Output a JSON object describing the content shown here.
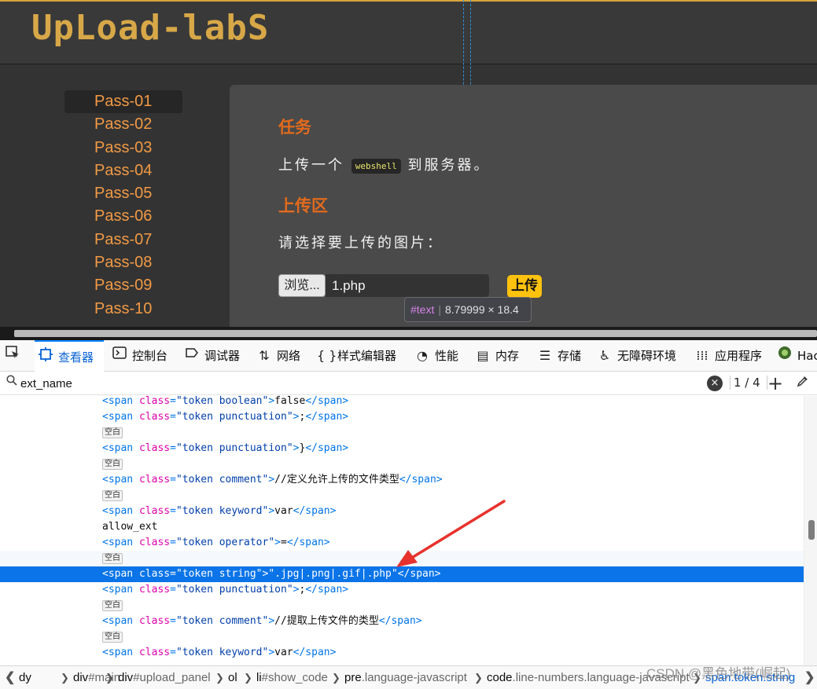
{
  "page": {
    "logo": "UpLoad-labS",
    "menu": [
      "Pass-01",
      "Pass-02",
      "Pass-03",
      "Pass-04",
      "Pass-05",
      "Pass-06",
      "Pass-07",
      "Pass-08",
      "Pass-09",
      "Pass-10"
    ],
    "task_title": "任务",
    "task_pre": "上传一个",
    "task_code": "webshell",
    "task_post": "到服务器。",
    "upload_title": "上传区",
    "upload_prompt": "请选择要上传的图片：",
    "browse_label": "浏览...",
    "file_name": "1.php",
    "upload_button": "上传",
    "tooltip_node": "#text",
    "tooltip_size": "8.79999 × 18.4"
  },
  "devtools": {
    "tabs": [
      {
        "label": "查看器",
        "icon": "inspector-icon"
      },
      {
        "label": "控制台",
        "icon": "console-icon"
      },
      {
        "label": "调试器",
        "icon": "debugger-icon"
      },
      {
        "label": "网络",
        "icon": "network-icon"
      },
      {
        "label": "样式编辑器",
        "icon": "style-editor-icon"
      },
      {
        "label": "性能",
        "icon": "performance-icon"
      },
      {
        "label": "内存",
        "icon": "memory-icon"
      },
      {
        "label": "存储",
        "icon": "storage-icon"
      },
      {
        "label": "无障碍环境",
        "icon": "accessibility-icon"
      },
      {
        "label": "应用程序",
        "icon": "application-icon"
      },
      {
        "label": "Hac",
        "icon": "hackbar-icon"
      }
    ],
    "search_value": "ext_name",
    "match_count": "1 / 4",
    "whitespace_badge": "空白",
    "rows": [
      {
        "kind": "span",
        "cls": "token boolean",
        "text": "false"
      },
      {
        "kind": "span",
        "cls": "token punctuation",
        "text": ";"
      },
      {
        "kind": "badge"
      },
      {
        "kind": "span",
        "cls": "token punctuation",
        "text": "}"
      },
      {
        "kind": "badge"
      },
      {
        "kind": "span",
        "cls": "token comment",
        "text": "//定义允许上传的文件类型"
      },
      {
        "kind": "badge"
      },
      {
        "kind": "span",
        "cls": "token keyword",
        "text": "var"
      },
      {
        "kind": "text",
        "text": "allow_ext"
      },
      {
        "kind": "span",
        "cls": "token operator",
        "text": "="
      },
      {
        "kind": "badge"
      },
      {
        "kind": "span",
        "cls": "token string",
        "text": "\".jpg|.png|.gif|.php\"",
        "highlight": true
      },
      {
        "kind": "span",
        "cls": "token punctuation",
        "text": ";"
      },
      {
        "kind": "badge"
      },
      {
        "kind": "span",
        "cls": "token comment",
        "text": "//提取上传文件的类型"
      },
      {
        "kind": "badge"
      },
      {
        "kind": "span",
        "cls": "token keyword",
        "text": "var"
      }
    ],
    "breadcrumbs": [
      {
        "el": "dy",
        "sel": ""
      },
      {
        "el": "div",
        "sel": "#main"
      },
      {
        "el": "div",
        "sel": "#upload_panel"
      },
      {
        "el": "ol",
        "sel": ""
      },
      {
        "el": "li",
        "sel": "#show_code"
      },
      {
        "el": "pre",
        "sel": ".language-javascript"
      },
      {
        "el": "code",
        "sel": ".line-numbers.language-javascript"
      },
      {
        "el": "span",
        "sel": ".token.string",
        "active": true
      }
    ],
    "watermark": "CSDN @黑色地带(崛起)"
  }
}
